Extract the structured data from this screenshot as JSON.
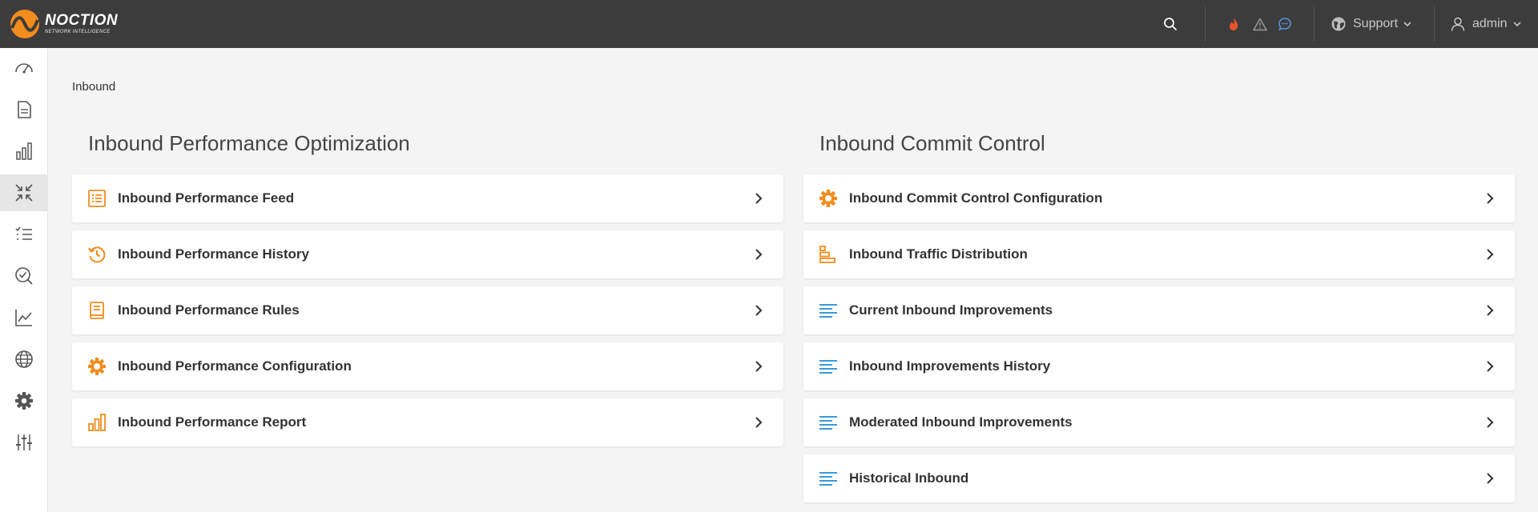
{
  "brand": {
    "name": "NOCTION",
    "tagline": "NETWORK INTELLIGENCE"
  },
  "topbar": {
    "support_label": "Support",
    "user_label": "admin"
  },
  "breadcrumb": "Inbound",
  "left_section": {
    "title": "Inbound Performance Optimization",
    "items": [
      {
        "label": "Inbound Performance Feed",
        "icon": "feed-list-icon"
      },
      {
        "label": "Inbound Performance History",
        "icon": "history-icon"
      },
      {
        "label": "Inbound Performance Rules",
        "icon": "rules-book-icon"
      },
      {
        "label": "Inbound Performance Configuration",
        "icon": "gear-icon"
      },
      {
        "label": "Inbound Performance Report",
        "icon": "bar-chart-icon"
      }
    ]
  },
  "right_section": {
    "title": "Inbound Commit Control",
    "items": [
      {
        "label": "Inbound Commit Control Configuration",
        "icon": "gear-icon"
      },
      {
        "label": "Inbound Traffic Distribution",
        "icon": "distribution-bars-icon"
      },
      {
        "label": "Current Inbound Improvements",
        "icon": "lines-icon"
      },
      {
        "label": "Inbound Improvements History",
        "icon": "lines-icon"
      },
      {
        "label": "Moderated Inbound Improvements",
        "icon": "lines-icon"
      },
      {
        "label": "Historical Inbound",
        "icon": "lines-icon"
      }
    ]
  },
  "colors": {
    "topbar": "#3c3c3c",
    "accent_orange": "#f28c1c",
    "accent_blue": "#3c9ad6",
    "fire_red": "#e8542e",
    "chat_blue": "#5a8fd8"
  }
}
